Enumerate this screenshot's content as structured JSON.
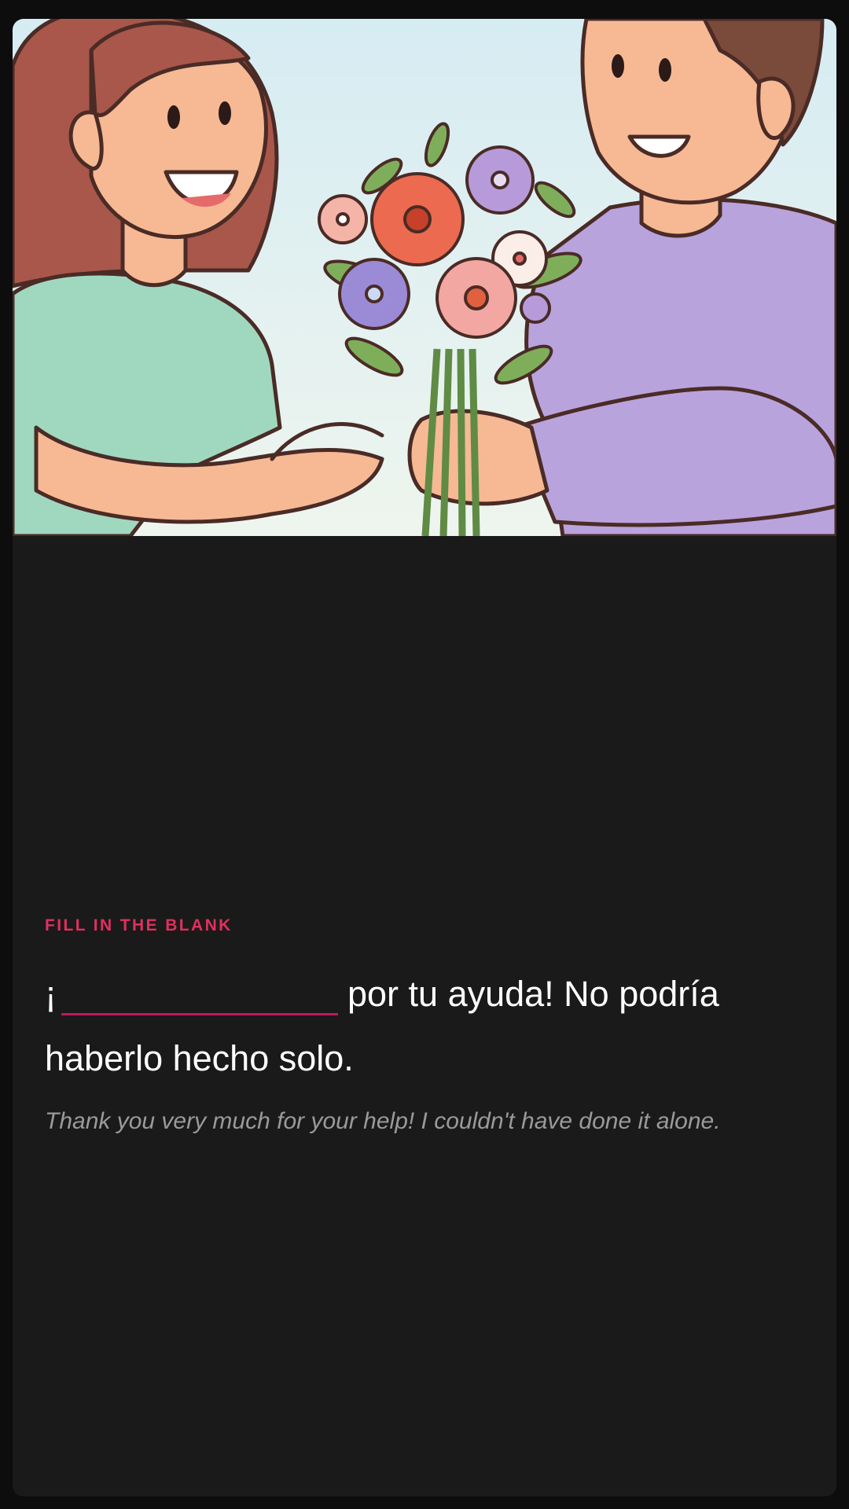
{
  "exercise": {
    "label": "FILL IN THE BLANK",
    "sentence_prefix": "¡",
    "sentence_suffix": "por tu ayuda! No podría haberlo hecho solo.",
    "translation": "Thank you very much for your help! I couldn't have done it alone."
  },
  "colors": {
    "accent": "#e0305f",
    "blank_underline": "#c2185b",
    "card_background": "#1a1a1a",
    "page_background": "#0d0d0d"
  },
  "icons": {
    "illustration": "two-people-giving-flowers-illustration"
  }
}
